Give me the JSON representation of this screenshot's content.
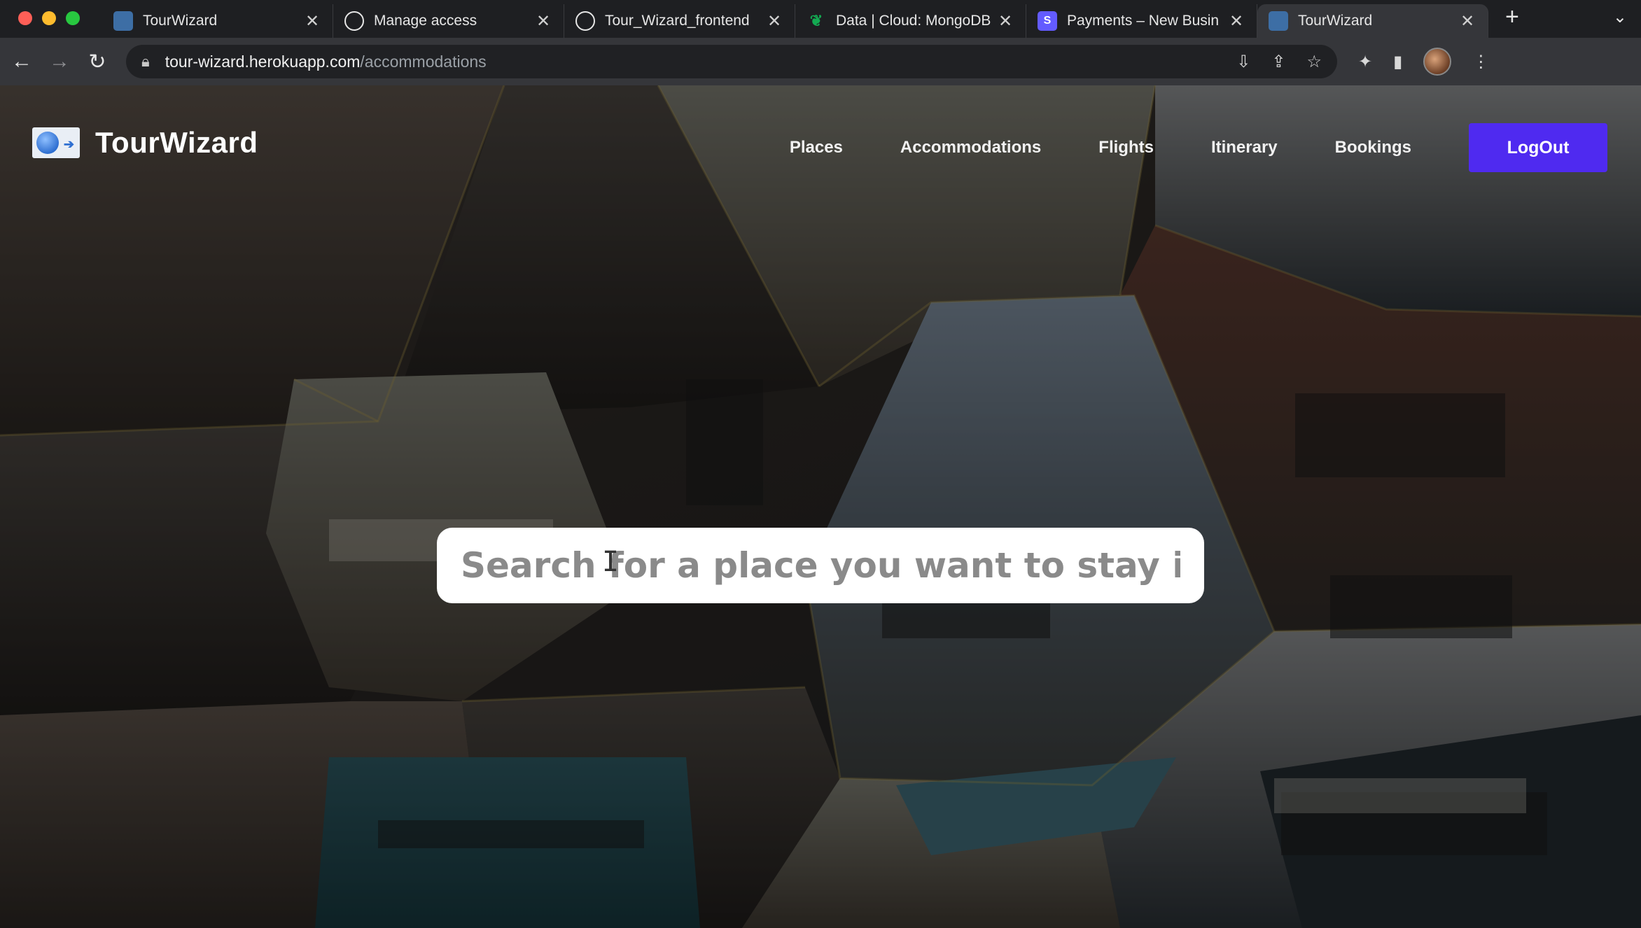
{
  "browser": {
    "tabs": [
      {
        "title": "TourWizard",
        "icon": "tourwizard-favicon",
        "active": false
      },
      {
        "title": "Manage access",
        "icon": "github-icon",
        "active": false
      },
      {
        "title": "Tour_Wizard_frontend",
        "icon": "github-icon",
        "active": false
      },
      {
        "title": "Data | Cloud: MongoDB",
        "icon": "mongodb-leaf-icon",
        "active": false
      },
      {
        "title": "Payments – New Busin",
        "icon": "stripe-icon",
        "active": false
      },
      {
        "title": "TourWizard",
        "icon": "tourwizard-favicon",
        "active": true
      }
    ],
    "url_host": "tour-wizard.herokuapp.com",
    "url_path": "/accommodations",
    "stripe_letter": "S",
    "new_tab_glyph": "+",
    "close_glyph": "✕"
  },
  "site": {
    "brand": "TourWizard",
    "nav": [
      "Places",
      "Accommodations",
      "Flights",
      "Itinerary",
      "Bookings"
    ],
    "logout_label": "LogOut",
    "accent_color": "#4f2af0"
  },
  "search": {
    "placeholder": "Search for a place you want to stay in",
    "value": ""
  }
}
